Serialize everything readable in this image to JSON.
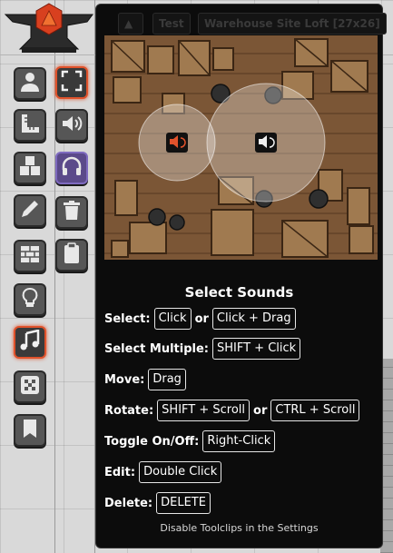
{
  "toolbar": {
    "left_column": [
      {
        "name": "token-tool",
        "icon": "user-icon"
      },
      {
        "name": "measure-tool",
        "icon": "ruler-icon"
      },
      {
        "name": "tiles-tool",
        "icon": "cubes-icon"
      },
      {
        "name": "drawing-tool",
        "icon": "pencil-icon"
      },
      {
        "name": "walls-tool",
        "icon": "bricks-icon"
      },
      {
        "name": "lighting-tool",
        "icon": "lightbulb-icon"
      },
      {
        "name": "sounds-tool",
        "icon": "music-icon",
        "active": true
      },
      {
        "name": "templates-tool",
        "icon": "checker-icon"
      },
      {
        "name": "notes-tool",
        "icon": "bookmark-icon"
      }
    ],
    "right_column": [
      {
        "name": "select-sounds",
        "icon": "expand-icon",
        "active": true
      },
      {
        "name": "ambient-sound",
        "icon": "volume-icon"
      },
      {
        "name": "preview-sound",
        "icon": "headphones-icon",
        "toggled": true
      },
      {
        "name": "clear-sounds",
        "icon": "trash-icon"
      },
      {
        "name": "sound-list",
        "icon": "clipboard-icon"
      }
    ]
  },
  "scene_tabs": [
    "Test",
    "Warehouse Site Loft [27x26]"
  ],
  "tooltip": {
    "title": "Select Sounds",
    "rows": [
      {
        "label": "Select:",
        "keys": [
          "Click",
          "Click + Drag"
        ]
      },
      {
        "label": "Select Multiple:",
        "keys": [
          "SHIFT + Click"
        ]
      },
      {
        "label": "Move:",
        "keys": [
          "Drag"
        ]
      },
      {
        "label": "Rotate:",
        "keys": [
          "SHIFT + Scroll",
          "CTRL + Scroll"
        ]
      },
      {
        "label": "Toggle On/Off:",
        "keys": [
          "Right-Click"
        ]
      },
      {
        "label": "Edit:",
        "keys": [
          "Double Click"
        ]
      },
      {
        "label": "Delete:",
        "keys": [
          "DELETE"
        ]
      }
    ],
    "or_word": "or",
    "footer_note": "Disable Toolclips in the Settings"
  },
  "colors": {
    "active_accent": "#e0522b",
    "toggle_accent": "#7f6bc0",
    "panel_bg": "#0c0c0c",
    "wood": "#7b5636"
  }
}
